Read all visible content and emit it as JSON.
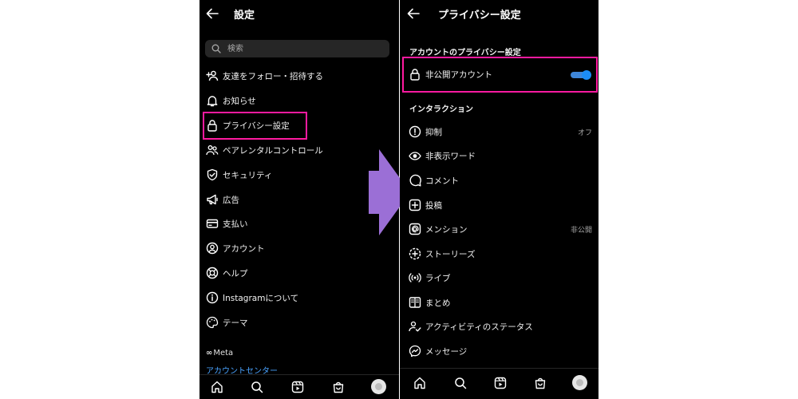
{
  "left_screen": {
    "title": "設定",
    "search_placeholder": "検索",
    "items": [
      {
        "label": "友達をフォロー・招待する",
        "icon": "add-person-icon"
      },
      {
        "label": "お知らせ",
        "icon": "bell-icon"
      },
      {
        "label": "プライバシー設定",
        "icon": "lock-icon"
      },
      {
        "label": "ペアレンタルコントロール",
        "icon": "people-icon"
      },
      {
        "label": "セキュリティ",
        "icon": "shield-check-icon"
      },
      {
        "label": "広告",
        "icon": "megaphone-icon"
      },
      {
        "label": "支払い",
        "icon": "card-icon"
      },
      {
        "label": "アカウント",
        "icon": "user-circle-icon"
      },
      {
        "label": "ヘルプ",
        "icon": "lifebuoy-icon"
      },
      {
        "label": "Instagramについて",
        "icon": "info-icon"
      },
      {
        "label": "テーマ",
        "icon": "palette-icon"
      }
    ],
    "meta_logo": "Meta",
    "accounts_center": "アカウントセンター"
  },
  "right_screen": {
    "title": "プライバシー設定",
    "account_section_title": "アカウントのプライバシー設定",
    "private_account": {
      "label": "非公開アカウント",
      "enabled": true
    },
    "interaction_section_title": "インタラクション",
    "items": [
      {
        "label": "抑制",
        "value": "オフ",
        "icon": "restrict-icon"
      },
      {
        "label": "非表示ワード",
        "value": "",
        "icon": "eye-icon"
      },
      {
        "label": "コメント",
        "value": "",
        "icon": "comment-icon"
      },
      {
        "label": "投稿",
        "value": "",
        "icon": "plus-square-icon"
      },
      {
        "label": "メンション",
        "value": "非公開",
        "icon": "at-icon"
      },
      {
        "label": "ストーリーズ",
        "value": "",
        "icon": "story-plus-icon"
      },
      {
        "label": "ライブ",
        "value": "",
        "icon": "live-icon"
      },
      {
        "label": "まとめ",
        "value": "",
        "icon": "guide-icon"
      },
      {
        "label": "アクティビティのステータス",
        "value": "",
        "icon": "activity-status-icon"
      },
      {
        "label": "メッセージ",
        "value": "",
        "icon": "messenger-icon"
      }
    ]
  },
  "colors": {
    "background": "#000000",
    "highlight_border": "#ff1aa0",
    "toggle_on": "#1c8cf5",
    "link": "#4aa3ff",
    "arrow": "#9b6fd6"
  }
}
